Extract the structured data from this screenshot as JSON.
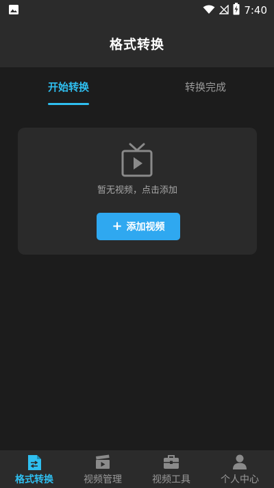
{
  "status_bar": {
    "time": "7:40"
  },
  "header": {
    "title": "格式转换"
  },
  "tabs": [
    {
      "label": "开始转换",
      "active": true
    },
    {
      "label": "转换完成",
      "active": false
    }
  ],
  "empty_state": {
    "icon": "tv-play-icon",
    "message": "暂无视频，点击添加",
    "button_icon": "plus-icon",
    "button_label": "添加视频"
  },
  "bottom_nav": [
    {
      "label": "格式转换",
      "icon": "convert-doc-icon",
      "active": true
    },
    {
      "label": "视频管理",
      "icon": "clapperboard-icon",
      "active": false
    },
    {
      "label": "视频工具",
      "icon": "toolbox-icon",
      "active": false
    },
    {
      "label": "个人中心",
      "icon": "user-icon",
      "active": false
    }
  ],
  "colors": {
    "accent": "#2fbff0",
    "button": "#2fa8f0",
    "background": "#1c1c1c",
    "bar": "#2b2b2b",
    "card": "#2a2a2a"
  }
}
